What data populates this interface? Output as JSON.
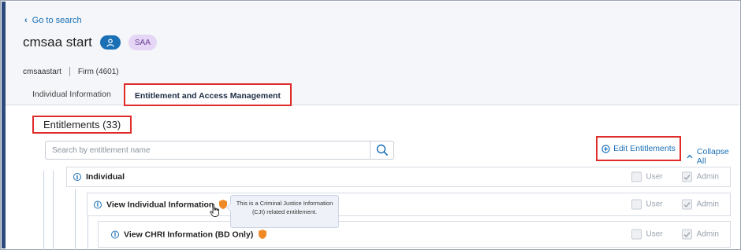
{
  "nav": {
    "back_label": "Go to search"
  },
  "header": {
    "title": "cmsaa start",
    "role_badge": "SAA",
    "username": "cmsaastart",
    "firm": "Firm (4601)"
  },
  "tabs": [
    {
      "label": "Individual Information",
      "active": false
    },
    {
      "label": "Entitlement and Access Management",
      "active": true
    }
  ],
  "entitlements": {
    "heading": "Entitlements (33)",
    "search_placeholder": "Search by entitlement name",
    "edit_label": "Edit Entitlements",
    "collapse_label": "Collapse All",
    "rows": [
      {
        "label": "Individual",
        "cji": false,
        "user_label": "User",
        "admin_label": "Admin",
        "user_checked": false,
        "admin_checked": true
      },
      {
        "label": "View Individual Information",
        "cji": true,
        "user_label": "User",
        "admin_label": "Admin",
        "user_checked": false,
        "admin_checked": true
      },
      {
        "label": "View CHRI Information (BD Only)",
        "cji": true,
        "user_label": "User",
        "admin_label": "Admin",
        "user_checked": false,
        "admin_checked": true
      }
    ],
    "tooltip": "This is a Criminal Justice Information (CJI) related entitlement."
  },
  "colors": {
    "accent": "#1a6fb5",
    "highlight": "#e02b2b",
    "cji_shield": "#f08a24",
    "saa_badge_bg": "#e6d6f5",
    "rail": "#2d4a7c"
  }
}
